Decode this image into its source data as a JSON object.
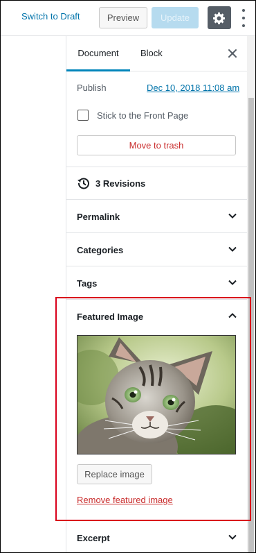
{
  "toolbar": {
    "switch_to_draft": "Switch to Draft",
    "preview": "Preview",
    "update": "Update",
    "settings_icon": "gear-icon",
    "more_icon": "more-vertical-icon"
  },
  "sidebar": {
    "tabs": [
      {
        "label": "Document",
        "active": true
      },
      {
        "label": "Block",
        "active": false
      }
    ],
    "close_icon": "close-icon",
    "status": {
      "publish_label": "Publish",
      "publish_date": "Dec 10, 2018 11:08 am",
      "sticky_label": "Stick to the Front Page",
      "sticky_checked": false,
      "trash_label": "Move to trash"
    },
    "revisions": {
      "icon": "history-icon",
      "label": "3 Revisions"
    },
    "panels": {
      "permalink": "Permalink",
      "categories": "Categories",
      "tags": "Tags",
      "featured_image": "Featured Image",
      "excerpt": "Excerpt"
    },
    "featured": {
      "expanded": true,
      "replace_label": "Replace image",
      "remove_label": "Remove featured image"
    }
  },
  "colors": {
    "accent": "#0073aa",
    "tab_active": "#0085ba",
    "destructive": "#c92c2c",
    "highlight": "#d9001b",
    "update_disabled": "#b6dbef",
    "settings_bg": "#555d66"
  }
}
